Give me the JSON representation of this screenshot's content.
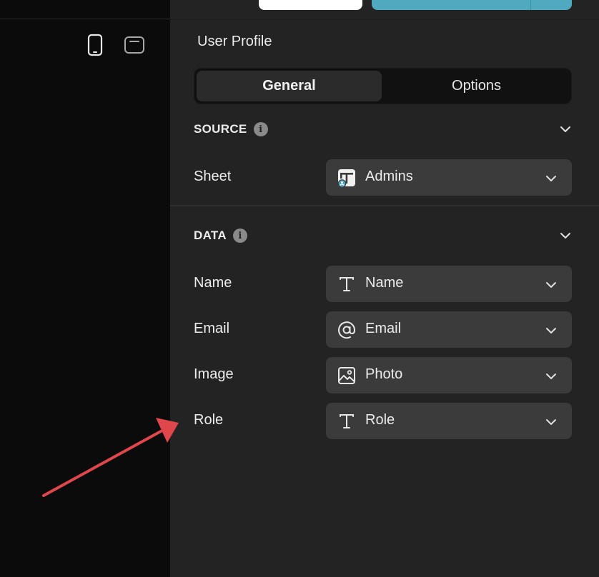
{
  "panel": {
    "title": "User Profile",
    "tabs": [
      {
        "label": "General",
        "active": true
      },
      {
        "label": "Options",
        "active": false
      }
    ]
  },
  "source": {
    "heading": "SOURCE",
    "rows": [
      {
        "label": "Sheet",
        "value": "Admins",
        "icon": "sheet-icon"
      }
    ]
  },
  "data": {
    "heading": "DATA",
    "rows": [
      {
        "label": "Name",
        "value": "Name",
        "icon": "text-type-icon"
      },
      {
        "label": "Email",
        "value": "Email",
        "icon": "at-sign-icon"
      },
      {
        "label": "Image",
        "value": "Photo",
        "icon": "image-icon"
      },
      {
        "label": "Role",
        "value": "Role",
        "icon": "text-type-icon"
      }
    ]
  },
  "info_glyph": "i",
  "colors": {
    "accent": "#4fa9bf",
    "annotation_arrow": "#e0474c",
    "panel_bg": "#232323",
    "canvas_bg": "#0b0b0b",
    "select_bg": "#3b3b3b"
  }
}
